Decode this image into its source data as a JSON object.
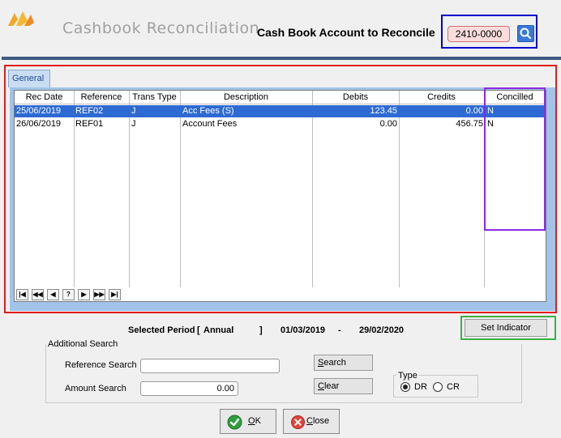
{
  "header": {
    "title": "Cashbook Reconciliation",
    "account_label": "Cash Book Account to Reconcile",
    "account_value": "2410-0000"
  },
  "tabs": [
    {
      "label": "General"
    }
  ],
  "table": {
    "columns": [
      "Rec Date",
      "Reference",
      "Trans Type",
      "Description",
      "Debits",
      "Credits",
      "Concilled"
    ],
    "rows": [
      {
        "rec_date": "25/06/2019",
        "reference": "REF02",
        "trans_type": "J",
        "description": "Acc Fees (S)",
        "debits": "123.45",
        "credits": "0.00",
        "concilled": "N",
        "selected": true
      },
      {
        "rec_date": "26/06/2019",
        "reference": "REF01",
        "trans_type": "J",
        "description": "Account Fees",
        "debits": "0.00",
        "credits": "456.75",
        "concilled": "N",
        "selected": false
      }
    ]
  },
  "navigator": {
    "first": "|◀",
    "prev_page": "◀◀",
    "prev": "◀",
    "find": "?",
    "next": "▶",
    "next_page": "▶▶",
    "last": "▶|"
  },
  "period": {
    "label": "Selected Period",
    "bracket_open": "[",
    "name": "Annual",
    "bracket_close": "]",
    "from": "01/03/2019",
    "dash": "-",
    "to": "29/02/2020"
  },
  "set_indicator_label": "Set Indicator",
  "search": {
    "group_title": "Additional Search",
    "reference_label": "Reference Search",
    "reference_value": "",
    "amount_label": "Amount Search",
    "amount_value": "0.00",
    "search_button": {
      "accel": "S",
      "rest": "earch"
    },
    "clear_button": {
      "accel": "C",
      "rest": "lear"
    },
    "type_title": "Type",
    "type_options": [
      {
        "label": "DR",
        "checked": true
      },
      {
        "label": "CR",
        "checked": false
      }
    ]
  },
  "footer": {
    "ok_button": {
      "accel": "O",
      "rest": "K"
    },
    "close_button": {
      "accel": "C",
      "rest": "lose"
    }
  },
  "colors": {
    "selected_row": "#2e6ad4",
    "header_rule": "#3d5a80",
    "panel": "#a3c3e8",
    "annotation_red": "#e21b1b",
    "annotation_blue": "#0000cc",
    "annotation_purple": "#8a2be2",
    "annotation_green": "#3cb043"
  },
  "icons": {
    "logo": "app-logo-icon",
    "account_search": "magnifier-icon",
    "ok": "check-circle-icon",
    "close": "x-circle-icon"
  }
}
